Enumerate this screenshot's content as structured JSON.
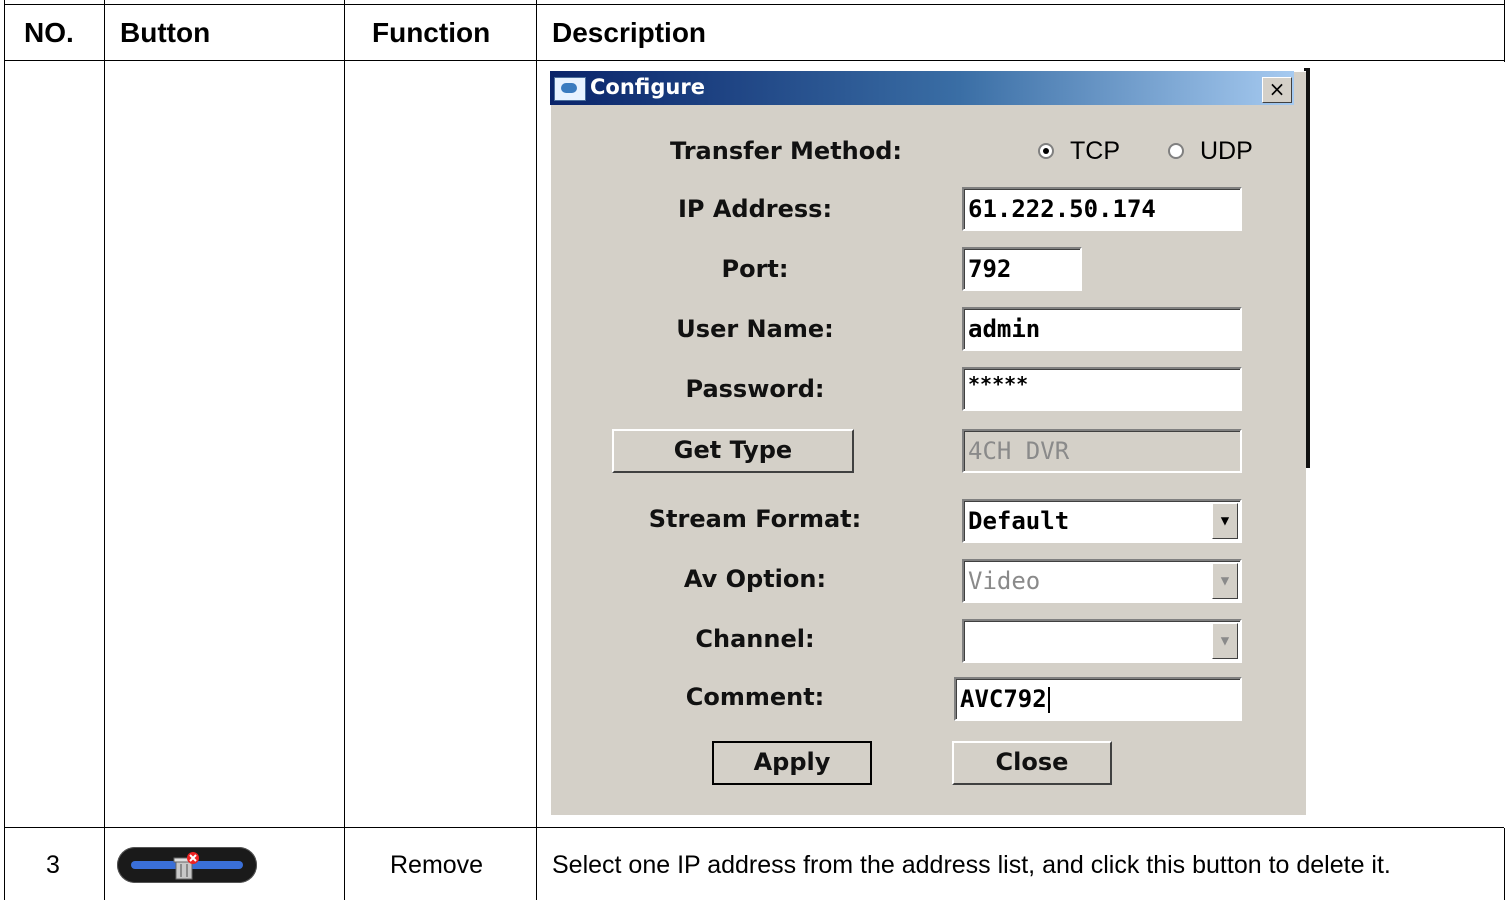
{
  "table": {
    "headers": {
      "no": "NO.",
      "button": "Button",
      "function": "Function",
      "description": "Description"
    },
    "row3": {
      "no": "3",
      "function": "Remove",
      "description": "Select one IP address from the address list, and click this button to delete it."
    }
  },
  "dialog": {
    "title": "Configure",
    "close_glyph": "×",
    "transfer_method_label": "Transfer Method:",
    "transfer_options": [
      "TCP",
      "UDP"
    ],
    "transfer_selected": "TCP",
    "ip_label": "IP Address:",
    "ip_value": "61.222.50.174",
    "port_label": "Port:",
    "port_value": "792",
    "user_label": "User Name:",
    "user_value": "admin",
    "password_label": "Password:",
    "password_value": "*****",
    "get_type_label": "Get Type",
    "type_value": "4CH DVR",
    "stream_format_label": "Stream Format:",
    "stream_format_value": "Default",
    "av_option_label": "Av Option:",
    "av_option_value": "Video",
    "channel_label": "Channel:",
    "channel_value": "",
    "comment_label": "Comment:",
    "comment_value": "AVC792",
    "apply_label": "Apply",
    "close_label": "Close"
  },
  "icons": {
    "remove_button": "trash-remove-icon",
    "dropdown": "chevron-down-icon"
  },
  "colors": {
    "titlebar_start": "#0a246a",
    "titlebar_end": "#a6caf0",
    "dialog_face": "#d4d0c8"
  }
}
